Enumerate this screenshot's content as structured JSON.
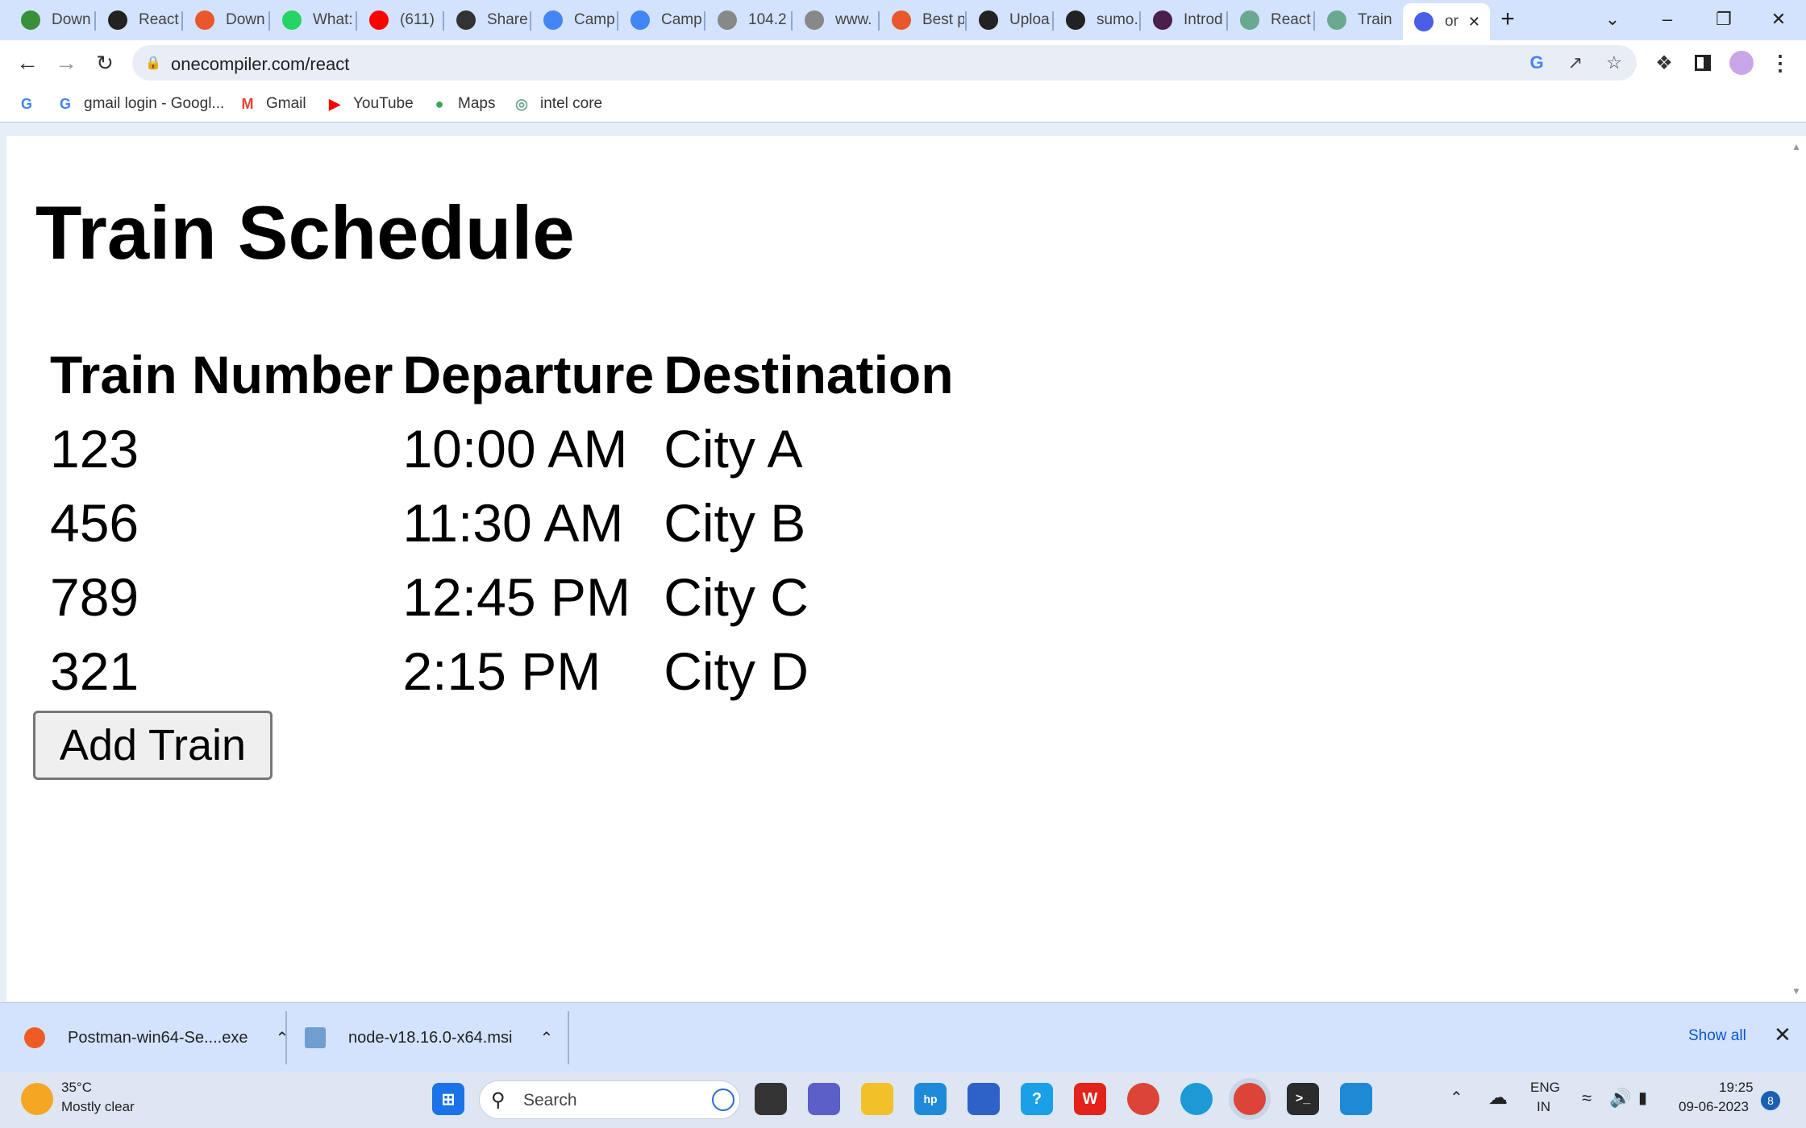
{
  "browser": {
    "tabs": [
      {
        "label": "Down",
        "icon": "shield-icon",
        "color": "#3a8f3a"
      },
      {
        "label": "React",
        "icon": "react-icon",
        "color": "#222"
      },
      {
        "label": "Down",
        "icon": "download-icon",
        "color": "#e8582c"
      },
      {
        "label": "What:",
        "icon": "whatsapp-icon",
        "color": "#25d366"
      },
      {
        "label": "(611)",
        "icon": "youtube-icon",
        "color": "#ff0000"
      },
      {
        "label": "Share",
        "icon": "globe-icon",
        "color": "#333"
      },
      {
        "label": "Camp",
        "icon": "docs-icon",
        "color": "#4285f4"
      },
      {
        "label": "Camp",
        "icon": "docs-icon",
        "color": "#4285f4"
      },
      {
        "label": "104.2",
        "icon": "globe-icon",
        "color": "#888"
      },
      {
        "label": "www.",
        "icon": "globe-icon",
        "color": "#888"
      },
      {
        "label": "Best p",
        "icon": "feather-icon",
        "color": "#e8582c"
      },
      {
        "label": "Uploa",
        "icon": "github-icon",
        "color": "#222"
      },
      {
        "label": "sumo.",
        "icon": "github-icon",
        "color": "#222"
      },
      {
        "label": "Introd",
        "icon": "openai-icon",
        "color": "#4b1f4b"
      },
      {
        "label": "React",
        "icon": "openai-icon",
        "color": "#6aa88f"
      },
      {
        "label": "Train",
        "icon": "openai-icon",
        "color": "#6aa88f"
      },
      {
        "label": "or",
        "icon": "code-icon",
        "color": "#4a5ee8"
      }
    ],
    "new_tab": "+",
    "url": "onecompiler.com/react",
    "bookmarks": [
      {
        "label": "",
        "icon": "google-icon"
      },
      {
        "label": "gmail login - Googl...",
        "icon": "google-icon"
      },
      {
        "label": "Gmail",
        "icon": "gmail-icon"
      },
      {
        "label": "YouTube",
        "icon": "youtube-icon"
      },
      {
        "label": "Maps",
        "icon": "maps-icon"
      },
      {
        "label": "intel core",
        "icon": "openai-icon"
      }
    ]
  },
  "page": {
    "title": "Train Schedule",
    "columns": [
      "Train Number",
      "Departure",
      "Destination"
    ],
    "rows": [
      [
        "123",
        "10:00 AM",
        "City A"
      ],
      [
        "456",
        "11:30 AM",
        "City B"
      ],
      [
        "789",
        "12:45 PM",
        "City C"
      ],
      [
        "321",
        "2:15 PM",
        "City D"
      ]
    ],
    "add_button": "Add Train"
  },
  "downloads": {
    "items": [
      {
        "name": "Postman-win64-Se....exe",
        "icon": "postman-icon"
      },
      {
        "name": "node-v18.16.0-x64.msi",
        "icon": "installer-icon"
      }
    ],
    "show_all": "Show all"
  },
  "taskbar": {
    "weather_temp": "35°C",
    "weather_desc": "Mostly clear",
    "search_placeholder": "Search",
    "lang_top": "ENG",
    "lang_bottom": "IN",
    "time": "19:25",
    "date": "09-06-2023",
    "notif_count": "8"
  }
}
